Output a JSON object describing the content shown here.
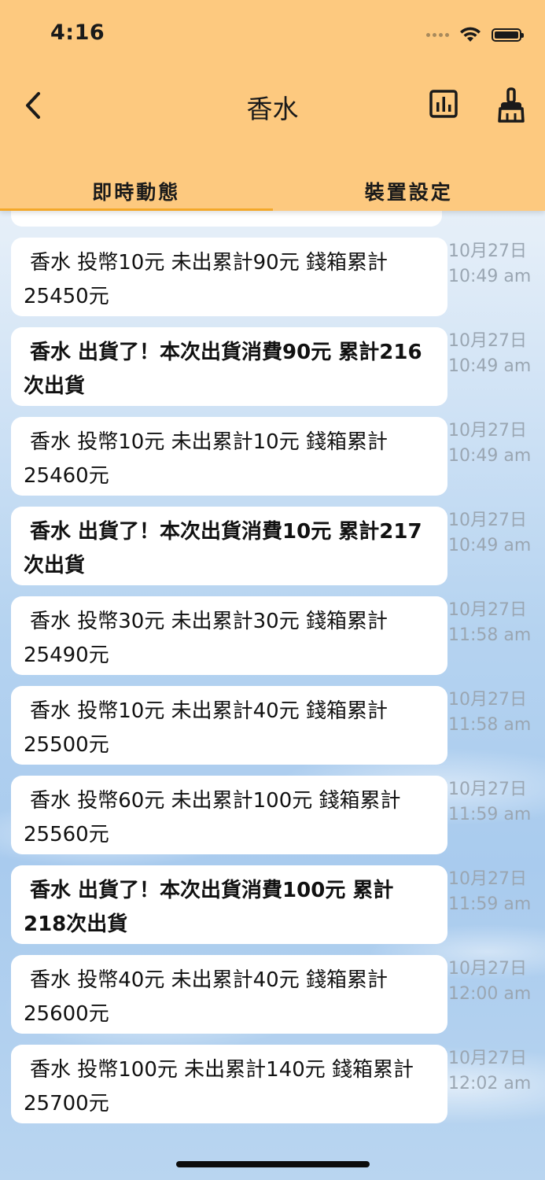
{
  "status_bar": {
    "time": "4:16"
  },
  "header": {
    "title": "香水",
    "back_icon": "chevron-left-icon",
    "chart_icon": "bar-chart-icon",
    "clean_icon": "broom-icon"
  },
  "tabs": [
    {
      "label": "即時動態",
      "active": true
    },
    {
      "label": "裝置設定",
      "active": false
    }
  ],
  "colors": {
    "header_bg": "#fdc97f",
    "tab_indicator": "#f4a82a",
    "timestamp": "#9aa6b2"
  },
  "messages": [
    {
      "text": "香水 投幣10元 未出累計90元 錢箱累計25450元",
      "date": "10月27日",
      "time": "10:49 am",
      "bold": false
    },
    {
      "text": "香水 出貨了！本次出貨消費90元 累計216次出貨",
      "date": "10月27日",
      "time": "10:49 am",
      "bold": true
    },
    {
      "text": "香水 投幣10元 未出累計10元 錢箱累計25460元",
      "date": "10月27日",
      "time": "10:49 am",
      "bold": false
    },
    {
      "text": "香水 出貨了！本次出貨消費10元 累計217次出貨",
      "date": "10月27日",
      "time": "10:49 am",
      "bold": true
    },
    {
      "text": "香水 投幣30元 未出累計30元 錢箱累計25490元",
      "date": "10月27日",
      "time": "11:58 am",
      "bold": false
    },
    {
      "text": "香水 投幣10元 未出累計40元 錢箱累計25500元",
      "date": "10月27日",
      "time": "11:58 am",
      "bold": false
    },
    {
      "text": "香水 投幣60元 未出累計100元 錢箱累計25560元",
      "date": "10月27日",
      "time": "11:59 am",
      "bold": false
    },
    {
      "text": "香水 出貨了！本次出貨消費100元 累計218次出貨",
      "date": "10月27日",
      "time": "11:59 am",
      "bold": true
    },
    {
      "text": "香水 投幣40元 未出累計40元 錢箱累計25600元",
      "date": "10月27日",
      "time": "12:00 am",
      "bold": false
    },
    {
      "text": "香水 投幣100元 未出累計140元 錢箱累計25700元",
      "date": "10月27日",
      "time": "12:02 am",
      "bold": false
    }
  ]
}
